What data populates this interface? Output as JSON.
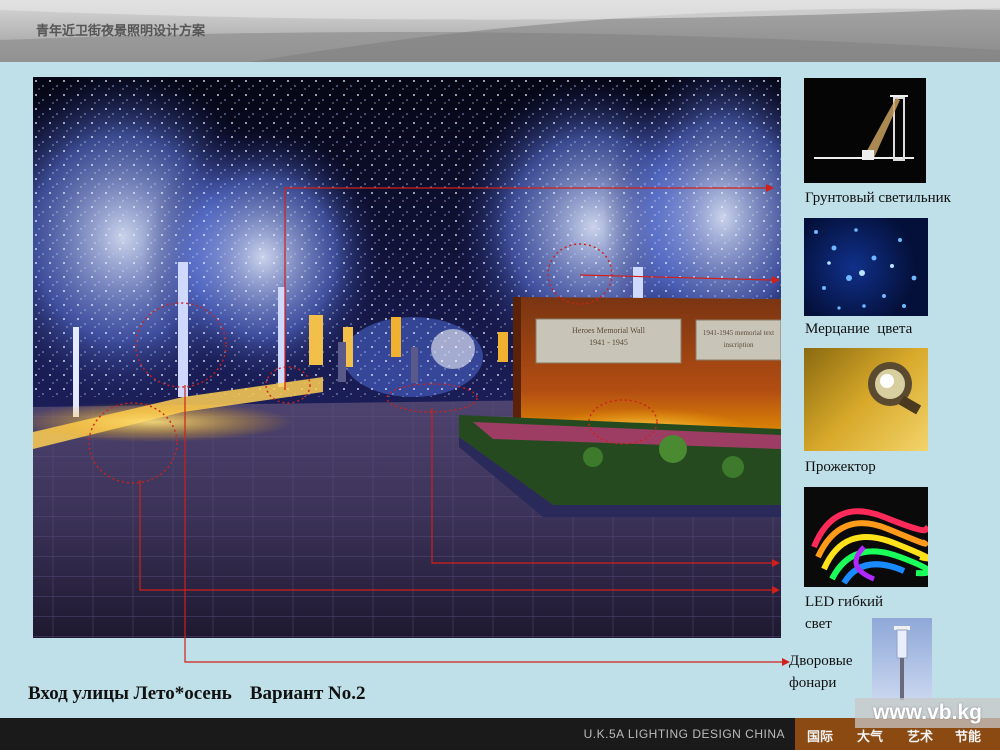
{
  "header": {
    "title": "青年近卫街夜景照明设计方案"
  },
  "scene": {
    "plaque_left": [
      "Heroes Memorial Wall",
      "1941 - 1945"
    ],
    "plaque_right": [
      "1941-1945 memorial text",
      "inscription"
    ]
  },
  "items": [
    {
      "label": "Грунтовый светильник",
      "icon": "ground-light-drawing"
    },
    {
      "label": "Мерцание  цвета",
      "icon": "twinkling-lights"
    },
    {
      "label": "Прожектор",
      "icon": "spotlight"
    },
    {
      "label_line1": "LED гибкий",
      "label_line2": "свет",
      "icon": "led-strip"
    },
    {
      "label_line1": "Дворовые",
      "label_line2": "фонари",
      "icon": "courtyard-lamp"
    }
  ],
  "caption": {
    "title": "Вход улицы Лето*осень",
    "variant": "Вариант No.2"
  },
  "footer": {
    "brand": "U.K.5A LIGHTING DESIGN CHINA",
    "tags": [
      "国际",
      "大气",
      "艺术",
      "节能"
    ]
  },
  "watermark": "www.vb.kg",
  "colors": {
    "background": "#bfe0e8",
    "arrow": "#d0201a",
    "footer": "#1a1a1a",
    "tag_bg": "#8a4a12"
  }
}
